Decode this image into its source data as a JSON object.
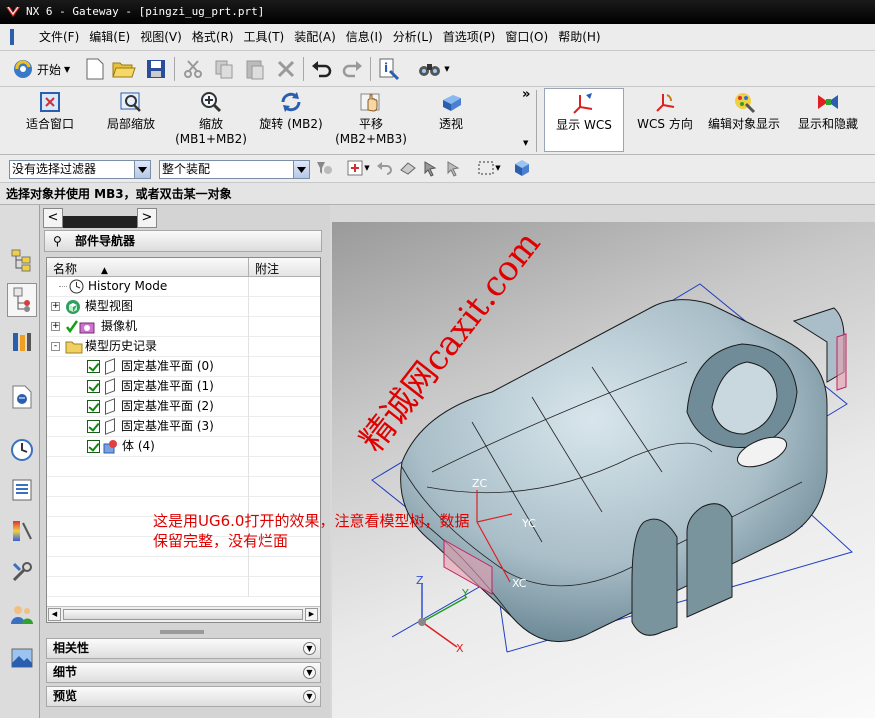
{
  "window": {
    "title": "NX 6 - Gateway - [pingzi_ug_prt.prt]"
  },
  "menu": [
    "文件(F)",
    "编辑(E)",
    "视图(V)",
    "格式(R)",
    "工具(T)",
    "装配(A)",
    "信息(I)",
    "分析(L)",
    "首选项(P)",
    "窗口(O)",
    "帮助(H)"
  ],
  "standard_toolbar": {
    "start_label": "开始",
    "start_icon": "nx-start-icon"
  },
  "view_toolbar": {
    "buttons": [
      {
        "label": "适合窗口",
        "icon": "fit-icon"
      },
      {
        "label": "局部缩放",
        "icon": "zoom-region-icon"
      },
      {
        "label": "缩放",
        "sub": "(MB1+MB2)",
        "icon": "zoom-icon"
      },
      {
        "label": "旋转 (MB2)",
        "icon": "rotate-icon"
      },
      {
        "label": "平移",
        "sub": "(MB2+MB3)",
        "icon": "pan-icon"
      },
      {
        "label": "透视",
        "icon": "perspective-icon"
      }
    ],
    "wcs_buttons": [
      {
        "label": "显示 WCS",
        "icon": "wcs-display-icon"
      },
      {
        "label": "WCS 方向",
        "icon": "wcs-orient-icon"
      },
      {
        "label": "编辑对象显示",
        "icon": "edit-display-icon"
      },
      {
        "label": "显示和隐藏",
        "icon": "show-hide-icon"
      }
    ],
    "overflow": "»"
  },
  "filter_bar": {
    "selection_filter": "没有选择过滤器",
    "scope": "整个装配"
  },
  "status": {
    "prompt": "选择对象并使用 MB3，或者双击某一对象"
  },
  "part_navigator": {
    "title": "部件导航器",
    "columns": [
      "名称",
      "附注"
    ],
    "rows": [
      {
        "label": "History Mode",
        "icon": "clock-icon"
      },
      {
        "label": "模型视图",
        "icon": "model-views-icon",
        "expander": "+"
      },
      {
        "label": "摄像机",
        "icon": "camera-icon",
        "expander": "+"
      },
      {
        "label": "模型历史记录",
        "icon": "folder-icon",
        "expander": "-"
      },
      {
        "label": "固定基准平面 (0)",
        "icon": "datum-plane-icon"
      },
      {
        "label": "固定基准平面 (1)",
        "icon": "datum-plane-icon"
      },
      {
        "label": "固定基准平面 (2)",
        "icon": "datum-plane-icon"
      },
      {
        "label": "固定基准平面 (3)",
        "icon": "datum-plane-icon"
      },
      {
        "label": "体 (4)",
        "icon": "body-icon"
      }
    ],
    "panels": [
      "相关性",
      "细节",
      "预览"
    ]
  },
  "viewport": {
    "axes": {
      "xc": "XC",
      "yc": "YC",
      "zc": "ZC",
      "x": "X",
      "y": "Y",
      "z": "Z"
    },
    "annotation": "这是用UG6.0打开的效果，注意看模型树，数据保留完整，没有烂面",
    "watermark": "精诚网caxit.com"
  },
  "colors": {
    "accent": "#2a5fb0",
    "annotation": "#e00000",
    "titlebar": "#000000"
  }
}
